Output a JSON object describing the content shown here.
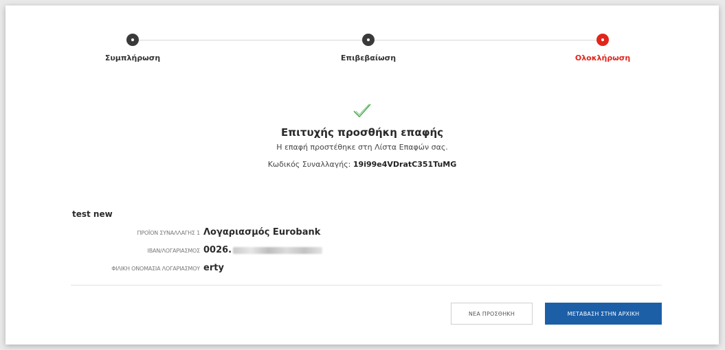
{
  "stepper": {
    "steps": [
      {
        "label": "Συμπλήρωση",
        "state": "done"
      },
      {
        "label": "Επιβεβαίωση",
        "state": "done"
      },
      {
        "label": "Ολοκλήρωση",
        "state": "active"
      }
    ],
    "active_color": "#e2251b"
  },
  "success": {
    "icon": "checkmark-icon",
    "title": "Επιτυχής προσθήκη επαφής",
    "subtitle": "Η επαφή προστέθηκε στη Λίστα Επαφών σας.",
    "code_label": "Κωδικός Συναλλαγής:",
    "code_value": "19i99e4VDratC351TuMG"
  },
  "contact": {
    "name": "test new",
    "rows": [
      {
        "label": "ΠΡΟΪΟΝ ΣΥΝΑΛΛΑΓΗΣ 1",
        "value": "Λογαριασμός Eurobank"
      },
      {
        "label": "IBAN/ΛΟΓΑΡΙΑΣΜΟΣ",
        "value": "0026."
      },
      {
        "label": "ΦΙΛΙΚΗ ΟΝΟΜΑΣΙΑ ΛΟΓΑΡΙΑΣΜΟΥ",
        "value": "erty"
      }
    ]
  },
  "actions": {
    "secondary_label": "ΝΕΑ ΠΡΟΣΘΗΚΗ",
    "primary_label": "ΜΕΤΑΒΑΣΗ ΣΤΗΝ ΑΡΧΙΚΗ",
    "primary_color": "#1c5fa7"
  }
}
